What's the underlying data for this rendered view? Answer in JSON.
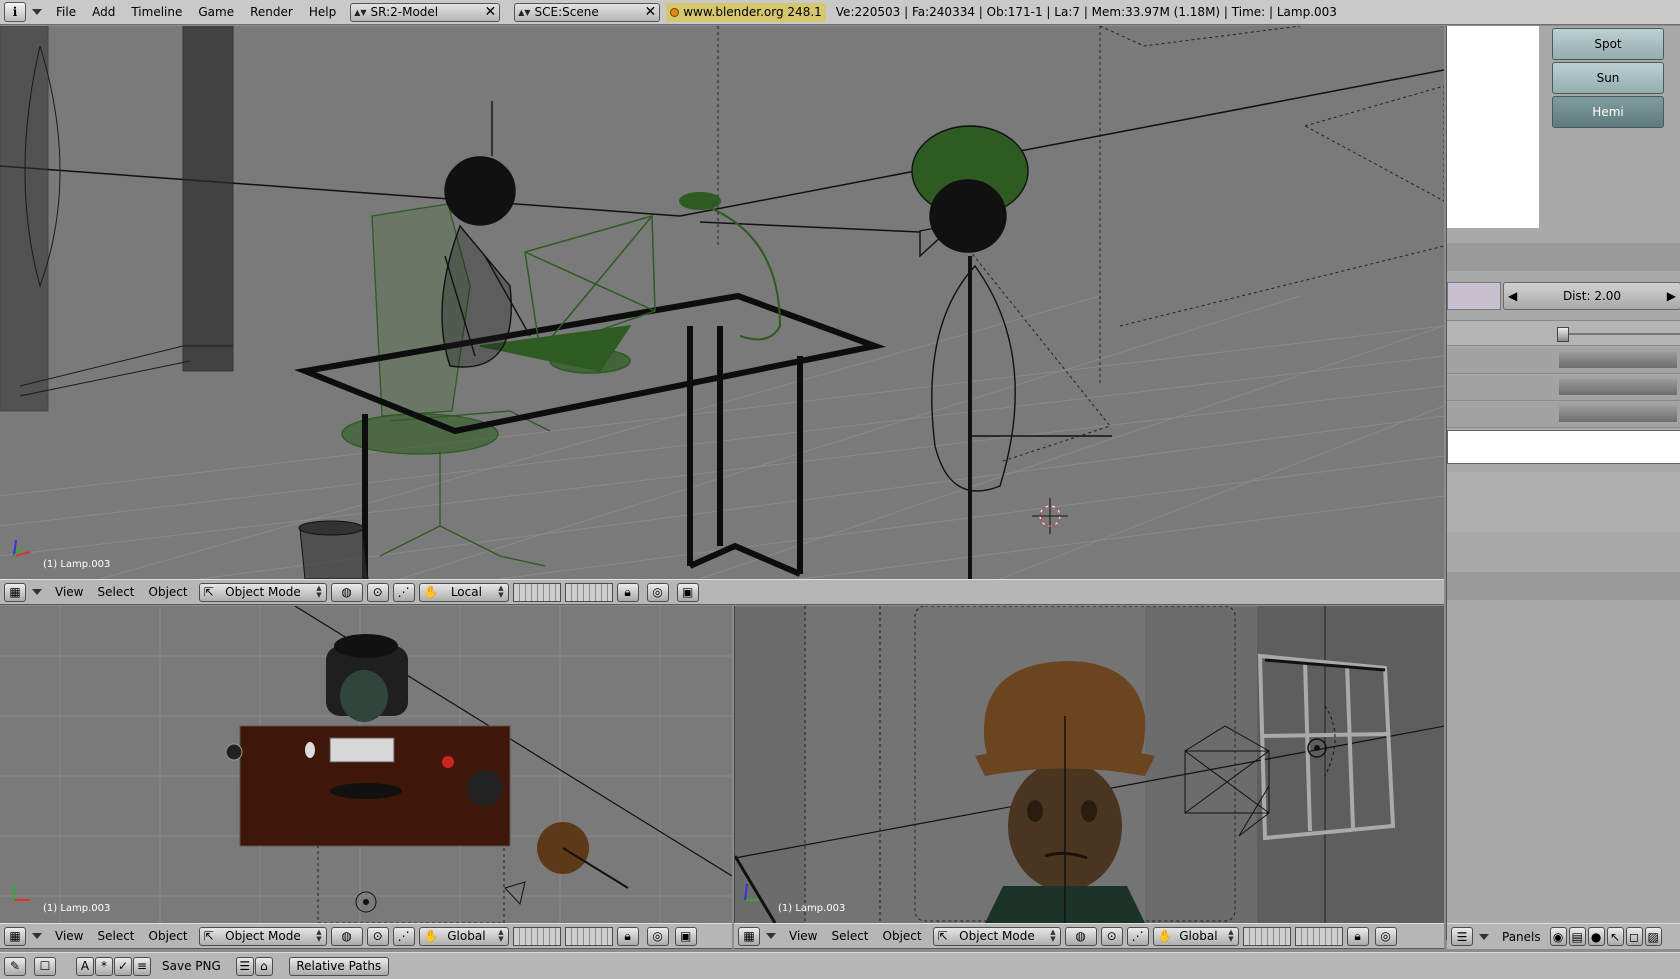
{
  "topbar": {
    "info_glyph": "i",
    "menus": [
      "File",
      "Add",
      "Timeline",
      "Game",
      "Render",
      "Help"
    ],
    "screen_field": "SR:2-Model",
    "scene_field": "SCE:Scene",
    "url": "www.blender.org 248.1",
    "stats": "Ve:220503 | Fa:240334 | Ob:171-1 | La:7  | Mem:33.97M (1.18M)  | Time: | Lamp.003",
    "close_glyph": "✕"
  },
  "viewport_top": {
    "label": "(1) Lamp.003",
    "header": {
      "menus": [
        "View",
        "Select",
        "Object"
      ],
      "mode": "Object Mode",
      "orientation": "Local"
    }
  },
  "viewport_bottom_left": {
    "label": "(1) Lamp.003",
    "header": {
      "menus": [
        "View",
        "Select",
        "Object"
      ],
      "mode": "Object Mode",
      "orientation": "Global"
    }
  },
  "viewport_bottom_right": {
    "label": "(1) Lamp.003",
    "header": {
      "menus": [
        "View",
        "Select",
        "Object"
      ],
      "mode": "Object Mode",
      "orientation": "Global"
    }
  },
  "right_panel": {
    "lamp_types": [
      "Spot",
      "Sun",
      "Hemi"
    ],
    "active_lamp_type": "Hemi",
    "dist_label": "Dist: 2.00",
    "footer_label": "Panels"
  },
  "bottom_bar": {
    "save_label": "Save PNG",
    "relative_paths_label": "Relative Paths"
  },
  "colors": {
    "topbar_bg": "#c9c9c9",
    "viewport_bg": "#7a7a7a",
    "wire_selected": "#2e5b22",
    "url_bg": "#d4c76d",
    "lamp_btn": "#9fb8ba",
    "lamp_btn_active": "#6d8a8c"
  }
}
